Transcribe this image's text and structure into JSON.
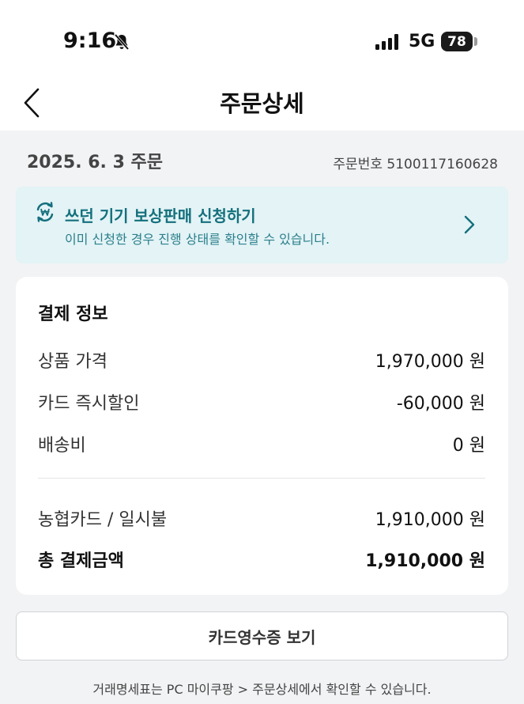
{
  "status_bar": {
    "time": "9:16",
    "network": "5G",
    "battery": "78"
  },
  "header": {
    "title": "주문상세"
  },
  "order": {
    "date": "2025. 6. 3 주문",
    "number": "주문번호 5100117160628"
  },
  "trade_in_banner": {
    "title": "쓰던 기기 보상판매 신청하기",
    "subtitle": "이미 신청한 경우 진행 상태를 확인할 수 있습니다.",
    "accent_color": "#14707c"
  },
  "payment": {
    "heading": "결제 정보",
    "rows": [
      {
        "label": "상품 가격",
        "value": "1,970,000 원"
      },
      {
        "label": "카드 즉시할인",
        "value": "-60,000 원"
      },
      {
        "label": "배송비",
        "value": "0 원"
      },
      {
        "label": "농협카드 / 일시불",
        "value": "1,910,000 원"
      },
      {
        "label": "총 결제금액",
        "value": "1,910,000 원"
      }
    ]
  },
  "receipt_button": "카드영수증 보기",
  "footer_note": "거래명세표는 PC 마이쿠팡 > 주문상세에서 확인할 수 있습니다."
}
